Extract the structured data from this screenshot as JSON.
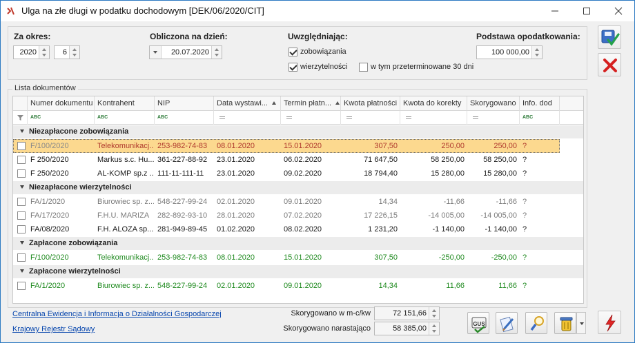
{
  "window": {
    "title": "Ulga na złe długi w podatku dochodowym [DEK/06/2020/CIT]"
  },
  "filters": {
    "period_label": "Za okres:",
    "year": "2020",
    "month": "6",
    "calc_date_label": "Obliczona na dzień:",
    "calc_date": "20.07.2020",
    "include_label": "Uwzględniając:",
    "chk_liabilities": "zobowiązania",
    "chk_receivables": "wierzytelności",
    "chk_overdue": "w tym przeterminowane 30 dni",
    "tax_base_label": "Podstawa opodatkowania:",
    "tax_base": "100 000,00"
  },
  "list": {
    "title": "Lista dokumentów",
    "columns": [
      "Numer dokumentu",
      "Kontrahent",
      "NIP",
      "Data wystawi...",
      "Termin płatn...",
      "Kwota płatności",
      "Kwota do korekty",
      "Skorygowano",
      "Info. dod"
    ],
    "filter_abc": "ABC",
    "groups": [
      {
        "label": "Niezapłacone zobowiązania",
        "rows": [
          {
            "doc": "F/100/2020",
            "contractor": "Telekomunikacj...",
            "nip": "253-982-74-83",
            "issue_date": "08.01.2020",
            "due_date": "15.01.2020",
            "amount": "307,50",
            "correction": "250,00",
            "corrected": "250,00",
            "info": "?"
          },
          {
            "doc": "F 250/2020",
            "contractor": "Markus s.c. Hu...",
            "nip": "361-227-88-92",
            "issue_date": "23.01.2020",
            "due_date": "06.02.2020",
            "amount": "71 647,50",
            "correction": "58 250,00",
            "corrected": "58 250,00",
            "info": "?"
          },
          {
            "doc": "F 250/2020",
            "contractor": "AL-KOMP sp.z ...",
            "nip": "111-11-111-11",
            "issue_date": "23.01.2020",
            "due_date": "09.02.2020",
            "amount": "18 794,40",
            "correction": "15 280,00",
            "corrected": "15 280,00",
            "info": "?"
          }
        ]
      },
      {
        "label": "Niezapłacone wierzytelności",
        "rows": [
          {
            "doc": "FA/1/2020",
            "contractor": "Biurowiec sp. z...",
            "nip": "548-227-99-24",
            "issue_date": "02.01.2020",
            "due_date": "09.01.2020",
            "amount": "14,34",
            "correction": "-11,66",
            "corrected": "-11,66",
            "info": "?"
          },
          {
            "doc": "FA/17/2020",
            "contractor": "F.H.U. MARIZA",
            "nip": "282-892-93-10",
            "issue_date": "28.01.2020",
            "due_date": "07.02.2020",
            "amount": "17 226,15",
            "correction": "-14 005,00",
            "corrected": "-14 005,00",
            "info": "?"
          },
          {
            "doc": "FA/08/2020",
            "contractor": "F.H. ALOZA sp...",
            "nip": "281-949-89-45",
            "issue_date": "01.02.2020",
            "due_date": "08.02.2020",
            "amount": "1 231,20",
            "correction": "-1 140,00",
            "corrected": "-1 140,00",
            "info": "?"
          }
        ]
      },
      {
        "label": "Zapłacone zobowiązania",
        "rows": [
          {
            "doc": "F/100/2020",
            "contractor": "Telekomunikacj...",
            "nip": "253-982-74-83",
            "issue_date": "08.01.2020",
            "due_date": "15.01.2020",
            "amount": "307,50",
            "correction": "-250,00",
            "corrected": "-250,00",
            "info": "?"
          }
        ]
      },
      {
        "label": "Zapłacone wierzytelności",
        "rows": [
          {
            "doc": "FA/1/2020",
            "contractor": "Biurowiec sp. z...",
            "nip": "548-227-99-24",
            "issue_date": "02.01.2020",
            "due_date": "09.01.2020",
            "amount": "14,34",
            "correction": "11,66",
            "corrected": "11,66",
            "info": "?"
          }
        ]
      }
    ]
  },
  "footer": {
    "link_ceidg": "Centralna Ewidencja i Informacja o Działalności Gospodarczej",
    "link_krs": "Krajowy Rejestr Sądowy",
    "corrected_month_label": "Skorygowano w m-c/kw",
    "corrected_month": "72 151,66",
    "corrected_total_label": "Skorygowano narastająco",
    "corrected_total": "58 385,00",
    "gus_label": "GUS"
  },
  "colors": {
    "selected_row": "#fcd98f",
    "green_text": "#1f8a1f",
    "link": "#0645ad",
    "window_border": "#2b79c2"
  }
}
